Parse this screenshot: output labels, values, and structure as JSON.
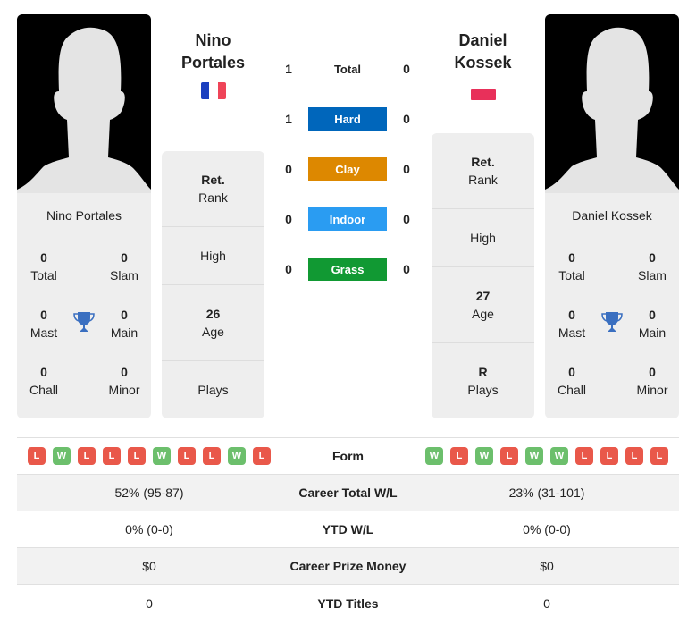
{
  "player_left": {
    "name_line1": "Nino",
    "name_line2": "Portales",
    "full_name": "Nino Portales",
    "flag": "france-flag",
    "titles": {
      "total": "0",
      "slam": "0",
      "mast": "0",
      "main": "0",
      "chall": "0",
      "minor": "0"
    },
    "info": {
      "rank_value": "Ret.",
      "rank_label": "Rank",
      "high_value": "",
      "high_label": "High",
      "age_value": "26",
      "age_label": "Age",
      "plays_value": "",
      "plays_label": "Plays"
    },
    "form": [
      "L",
      "W",
      "L",
      "L",
      "L",
      "W",
      "L",
      "L",
      "W",
      "L"
    ],
    "career_wl": "52% (95-87)",
    "ytd_wl": "0% (0-0)",
    "prize": "$0",
    "ytd_titles": "0"
  },
  "player_right": {
    "name_line1": "Daniel",
    "name_line2": "Kossek",
    "full_name": "Daniel Kossek",
    "flag": "poland-flag",
    "titles": {
      "total": "0",
      "slam": "0",
      "mast": "0",
      "main": "0",
      "chall": "0",
      "minor": "0"
    },
    "info": {
      "rank_value": "Ret.",
      "rank_label": "Rank",
      "high_value": "",
      "high_label": "High",
      "age_value": "27",
      "age_label": "Age",
      "plays_value": "R",
      "plays_label": "Plays"
    },
    "form": [
      "W",
      "L",
      "W",
      "L",
      "W",
      "W",
      "L",
      "L",
      "L",
      "L"
    ],
    "career_wl": "23% (31-101)",
    "ytd_wl": "0% (0-0)",
    "prize": "$0",
    "ytd_titles": "0"
  },
  "labels": {
    "total": "Total",
    "slam": "Slam",
    "mast": "Mast",
    "main": "Main",
    "chall": "Chall",
    "minor": "Minor",
    "form": "Form",
    "career_wl": "Career Total W/L",
    "ytd_wl": "YTD W/L",
    "prize": "Career Prize Money",
    "ytd_titles": "YTD Titles"
  },
  "h2h": [
    {
      "surface": "Total",
      "left": "1",
      "right": "0",
      "color": ""
    },
    {
      "surface": "Hard",
      "left": "1",
      "right": "0",
      "color": "#0066bb"
    },
    {
      "surface": "Clay",
      "left": "0",
      "right": "0",
      "color": "#dd8800"
    },
    {
      "surface": "Indoor",
      "left": "0",
      "right": "0",
      "color": "#2a9cf2"
    },
    {
      "surface": "Grass",
      "left": "0",
      "right": "0",
      "color": "#119933"
    }
  ]
}
